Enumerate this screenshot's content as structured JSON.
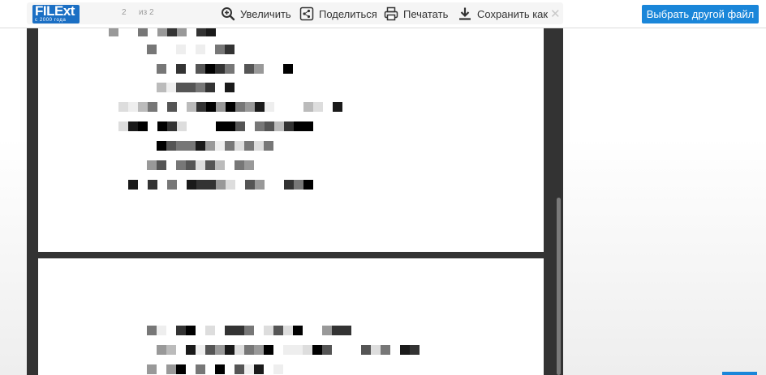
{
  "header": {
    "logo_text": "FILExt",
    "logo_subtitle": "с 2000 года",
    "page_number": "2",
    "page_of": "из 2",
    "choose_button_label": "Выбрать другой файл",
    "close_glyph": "✕"
  },
  "toolbar": {
    "items": [
      {
        "label": "Увеличить",
        "icon": "zoom-in-icon"
      },
      {
        "label": "Поделиться",
        "icon": "share-icon"
      },
      {
        "label": "Печатать",
        "icon": "printer-icon"
      },
      {
        "label": "Сохранить как",
        "icon": "download-icon"
      }
    ]
  },
  "document": {
    "total_pages": 2,
    "content_state": "pixelated"
  },
  "colors": {
    "accent": "#1a86d9",
    "logo_bg": "#1b6fc4",
    "viewer_bg": "#333333",
    "page_bg": "#ffffff"
  }
}
